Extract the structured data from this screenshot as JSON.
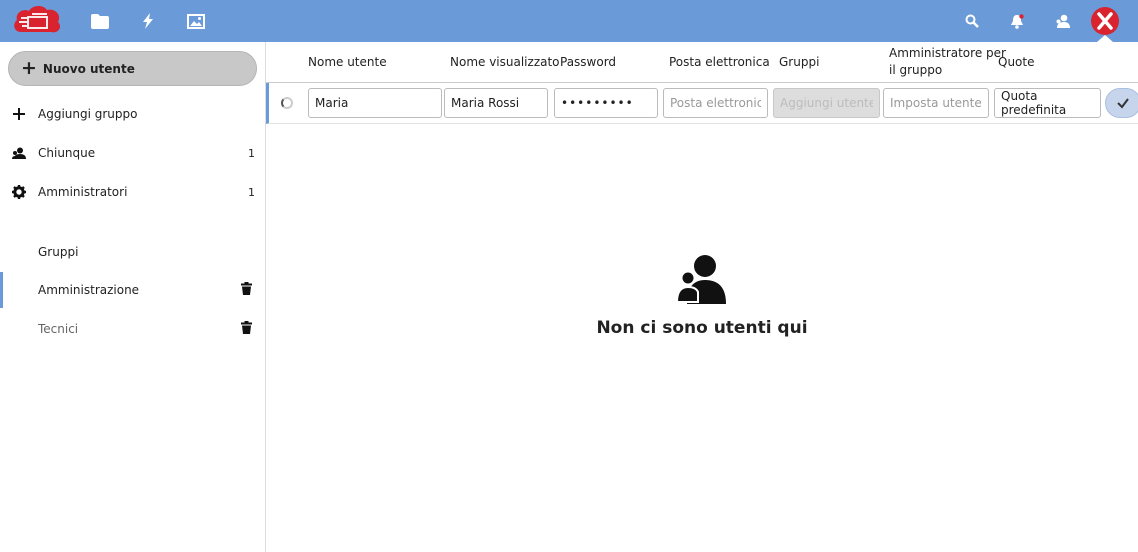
{
  "topbar": {
    "bg": "#6b9ad8",
    "logo_color": "#d9232e",
    "apps": [
      "folder-icon",
      "lightning-icon",
      "image-icon"
    ],
    "actions": [
      "search-icon",
      "bell-icon",
      "contacts-icon",
      "avatar"
    ]
  },
  "sidebar": {
    "new_user_label": "Nuovo utente",
    "add_group_label": "Aggiungi gruppo",
    "everyone": {
      "label": "Chiunque",
      "count": "1"
    },
    "admins": {
      "label": "Amministratori",
      "count": "1"
    },
    "groups_caption": "Gruppi",
    "groups": [
      {
        "label": "Amministrazione"
      },
      {
        "label": "Tecnici"
      }
    ]
  },
  "table": {
    "headers": {
      "username": "Nome utente",
      "display_name": "Nome visualizzato",
      "password": "Password",
      "email": "Posta elettronica",
      "groups": "Gruppi",
      "group_admin_1": "Amministratore per",
      "group_admin_2": "il gruppo",
      "quota": "Quote"
    },
    "new_user_form": {
      "username": "Maria",
      "display_name": "Maria Rossi",
      "password": "•••••••••",
      "email_placeholder": "Posta elettronica",
      "groups_placeholder": "Aggiungi utente al gruppo",
      "group_admin_placeholder": "Imposta utente come amministratore",
      "quota": "Quota predefinita"
    }
  },
  "empty_state": {
    "message": "Non ci sono utenti qui"
  }
}
